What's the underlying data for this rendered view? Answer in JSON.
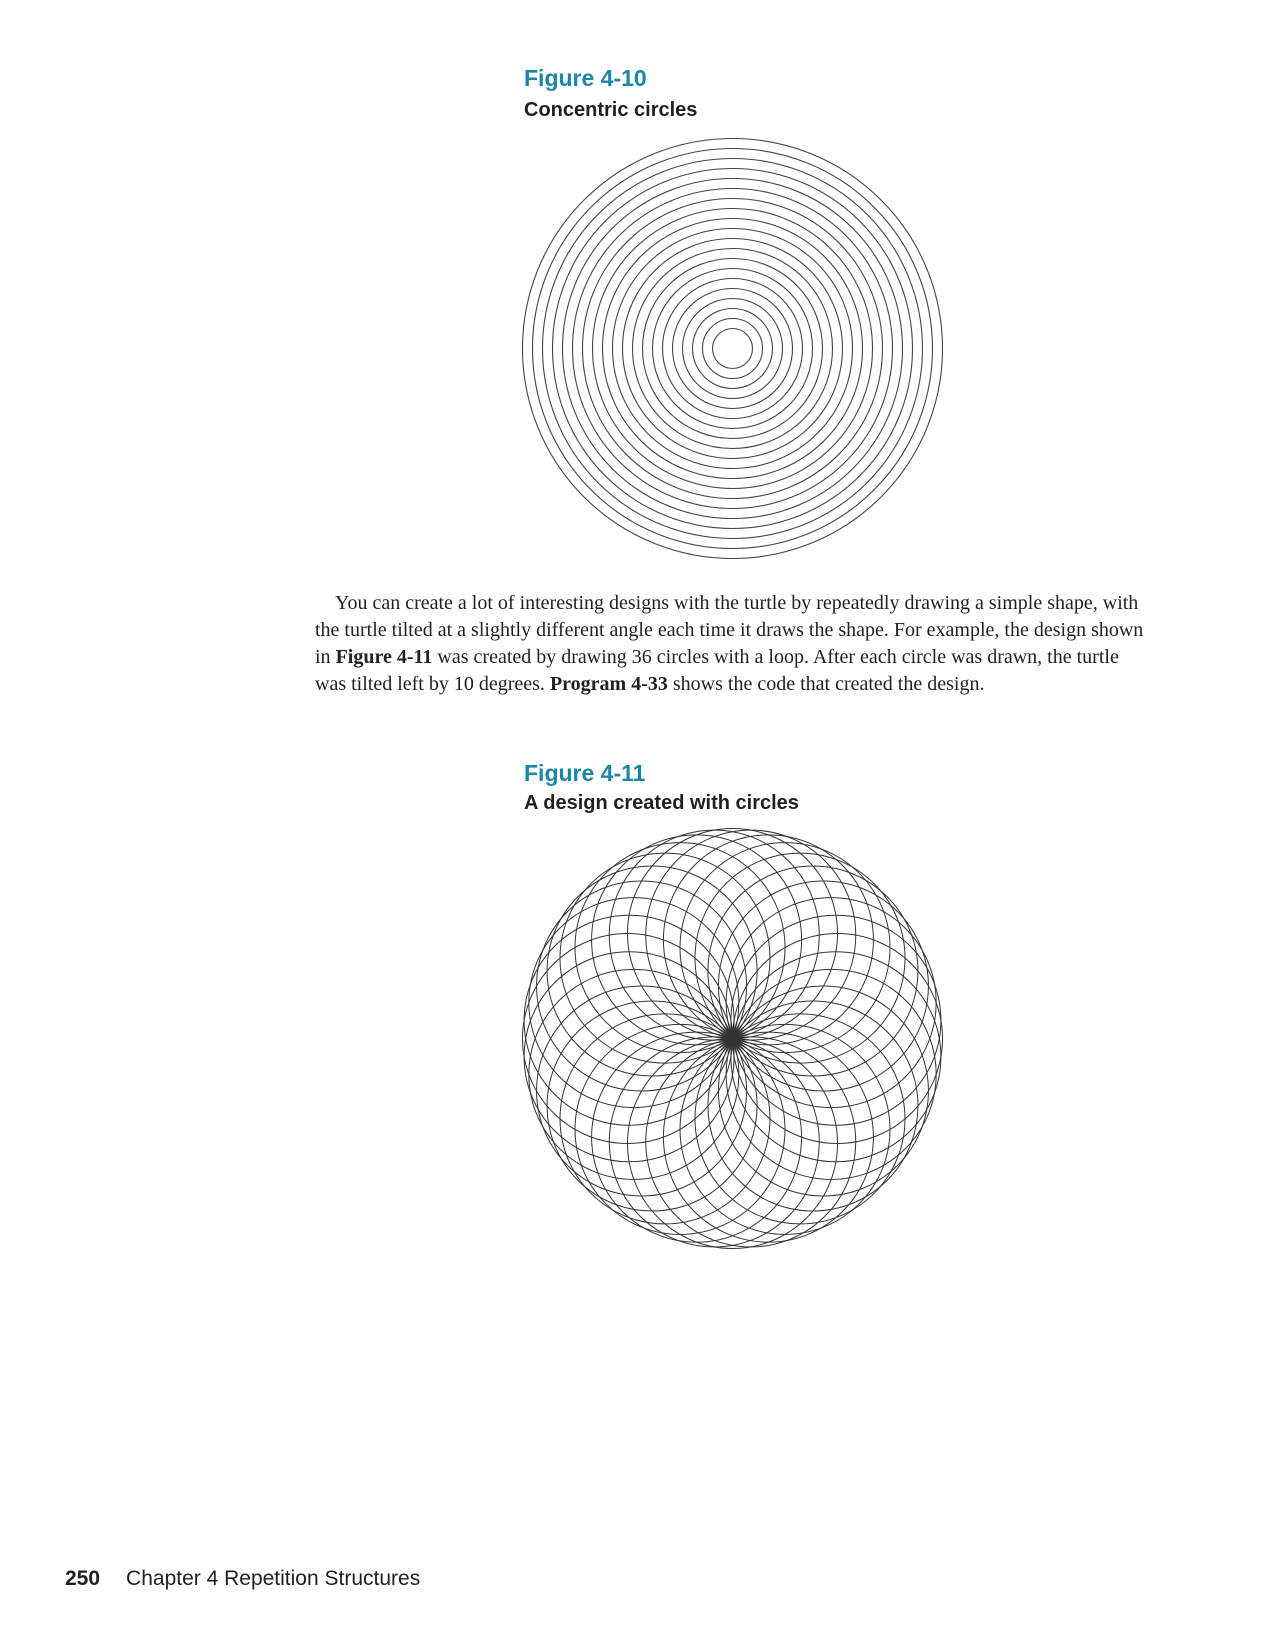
{
  "accent_color": "#1a86a8",
  "figure_4_10": {
    "label": "Figure 4-10",
    "caption": "Concentric circles",
    "circle_count": 20
  },
  "paragraph": {
    "t1": "You can create a lot of interesting designs with the turtle by repeatedly drawing a simple shape, with the turtle tilted at a slightly different angle each time it draws the shape. For example, the design shown in ",
    "b1": "Figure 4-11",
    "t2": " was created by drawing 36 circles with a loop. After each circle was drawn, the turtle was tilted left by 10 degrees. ",
    "b2": "Program 4-33",
    "t3": " shows the code that created the design."
  },
  "figure_4_11": {
    "label": "Figure 4-11",
    "caption": "A design created with circles",
    "circle_count": 36,
    "tilt_degrees": 10
  },
  "footer": {
    "page_number": "250",
    "chapter": "Chapter 4 Repetition Structures"
  }
}
